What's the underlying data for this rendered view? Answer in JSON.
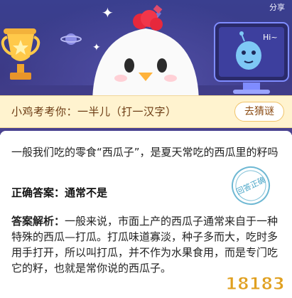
{
  "header": {
    "share_label": "分享"
  },
  "banner": {
    "monitor_text": "Hi~",
    "icons": [
      "trophy-icon",
      "planet-icon",
      "rocket-icon",
      "sparkle-icon",
      "chicken-mascot-icon",
      "monitor-icon",
      "alien-icon"
    ]
  },
  "quiz": {
    "prompt": "小鸡考考你：一半儿（打一汉字）",
    "guess_button": "去猜谜"
  },
  "content": {
    "question": "一般我们吃的零食“西瓜子”，是夏天常吃的西瓜里的籽吗",
    "answer_label": "正确答案：",
    "answer_value": "通常不是",
    "analysis_label": "答案解析：",
    "analysis_text": "一般来说，市面上产的西瓜子通常来自于一种特殊的西瓜—打瓜。打瓜味道寡淡，种子多而大，吃时多用手打开，所以叫打瓜，并不作为水果食用，而是专门吃它的籽，也就是常你说的西瓜子。",
    "stamp_text": "回答正确"
  },
  "watermark": {
    "text": "18183"
  },
  "colors": {
    "banner_bg": "#3c3a86",
    "quiz_bar_bg": "#fff3cf",
    "quiz_text": "#6b3a12",
    "stamp": "#4aa6c8",
    "watermark": "#e0a020"
  }
}
